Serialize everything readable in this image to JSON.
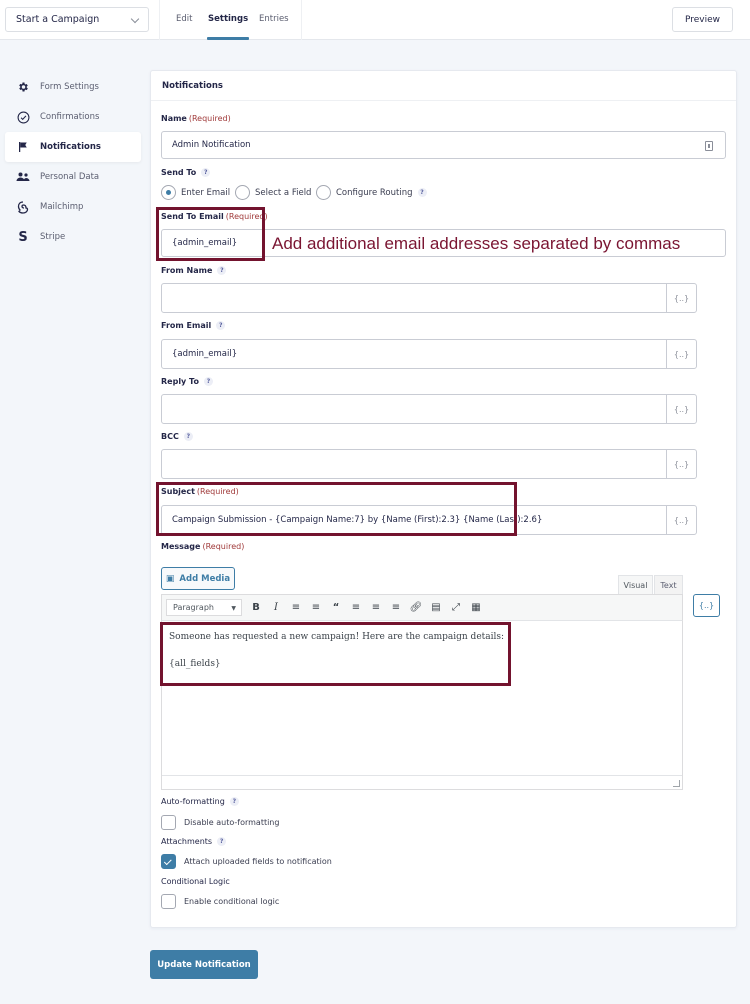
{
  "topbar": {
    "form_select": "Start a Campaign",
    "tabs": [
      {
        "label": "Edit",
        "active": false
      },
      {
        "label": "Settings",
        "active": true
      },
      {
        "label": "Entries",
        "active": false
      }
    ],
    "preview_label": "Preview"
  },
  "sidebar": {
    "items": [
      {
        "label": "Form Settings",
        "icon": "gear-icon",
        "active": false
      },
      {
        "label": "Confirmations",
        "icon": "check-circle-icon",
        "active": false
      },
      {
        "label": "Notifications",
        "icon": "flag-icon",
        "active": true
      },
      {
        "label": "Personal Data",
        "icon": "users-icon",
        "active": false
      },
      {
        "label": "Mailchimp",
        "icon": "mailchimp-icon",
        "active": false
      },
      {
        "label": "Stripe",
        "icon": "stripe-icon",
        "active": false
      }
    ]
  },
  "panel": {
    "title": "Notifications",
    "required_text": "(Required)",
    "name": {
      "label": "Name",
      "value": "Admin Notification"
    },
    "send_to": {
      "label": "Send To",
      "options": [
        {
          "label": "Enter Email",
          "selected": true
        },
        {
          "label": "Select a Field",
          "selected": false
        },
        {
          "label": "Configure Routing",
          "selected": false
        }
      ]
    },
    "send_to_email": {
      "label": "Send To Email",
      "value": "{admin_email}"
    },
    "from_name": {
      "label": "From Name",
      "value": ""
    },
    "from_email": {
      "label": "From Email",
      "value": "{admin_email}"
    },
    "reply_to": {
      "label": "Reply To",
      "value": ""
    },
    "bcc": {
      "label": "BCC",
      "value": ""
    },
    "subject": {
      "label": "Subject",
      "value": "Campaign Submission - {Campaign Name:7} by {Name (First):2.3} {Name (Last):2.6}"
    },
    "message": {
      "label": "Message",
      "add_media": "Add Media",
      "tab_visual": "Visual",
      "tab_text": "Text",
      "format_select": "Paragraph",
      "paragraphs": [
        "Someone has requested a new campaign! Here are the campaign details:",
        "{all_fields}"
      ]
    },
    "merge_tag_symbol": "{..}",
    "auto_formatting": {
      "label": "Auto-formatting",
      "checkbox_label": "Disable auto-formatting",
      "checked": false
    },
    "attachments": {
      "label": "Attachments",
      "checkbox_label": "Attach uploaded fields to notification",
      "checked": true
    },
    "conditional_logic": {
      "label": "Conditional Logic",
      "checkbox_label": "Enable conditional logic",
      "checked": false
    }
  },
  "annotation": {
    "text": "Add additional email addresses separated by commas",
    "color": "#73132e"
  },
  "update_button": "Update Notification",
  "colors": {
    "accent": "#3e7da6",
    "required": "#a03a3a"
  }
}
